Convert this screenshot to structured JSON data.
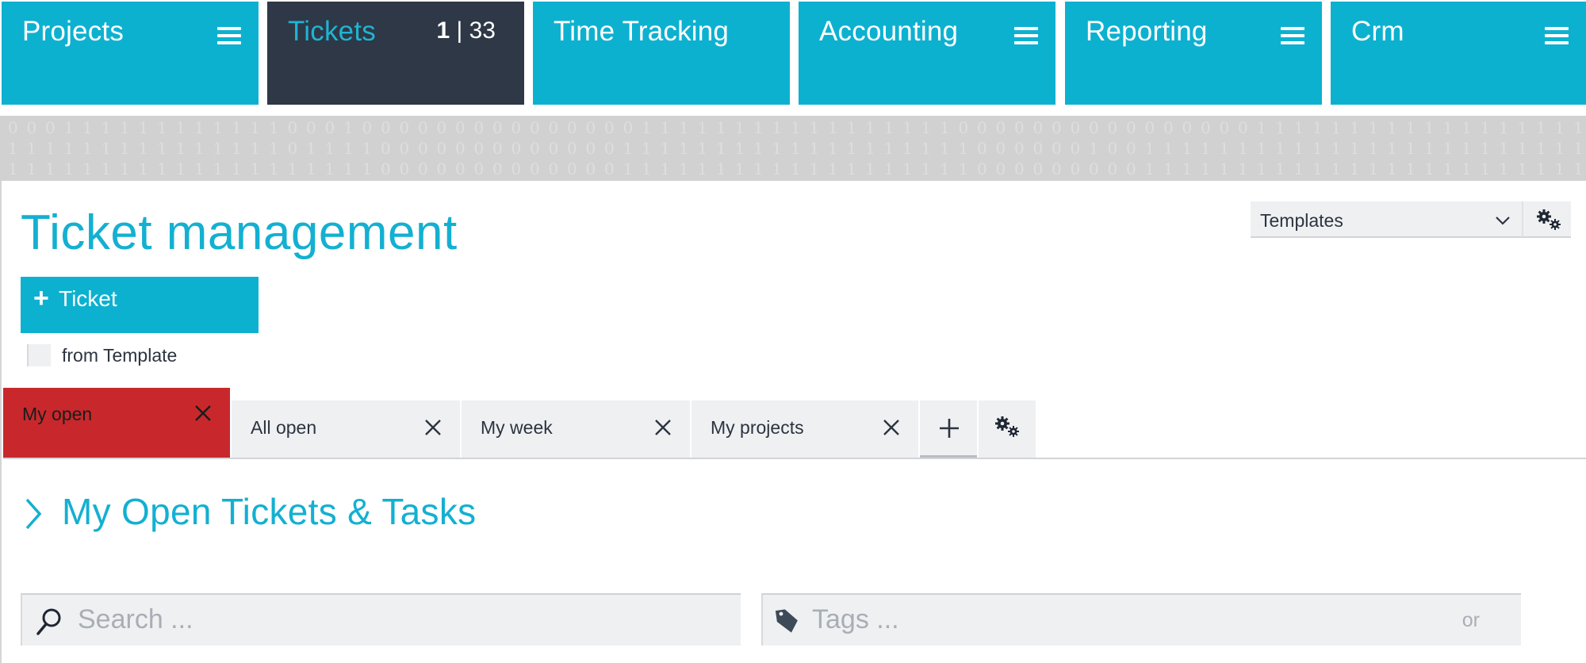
{
  "topnav": {
    "tiles": [
      {
        "label": "Projects",
        "icon": "menu-icon"
      },
      {
        "label": "Tickets",
        "badge_current": "1",
        "badge_separator": " | ",
        "badge_total": "33",
        "active": true
      },
      {
        "label": "Time Tracking"
      },
      {
        "label": "Accounting",
        "icon": "menu-icon"
      },
      {
        "label": "Reporting",
        "icon": "menu-icon"
      },
      {
        "label": "Crm",
        "icon": "menu-icon"
      }
    ]
  },
  "banner": {
    "rows": [
      "0001111111111110001000000000000000111111111111111110000000000000000111111111111111111",
      "1111111111111110111100000000000001111111111111111111000000100111111111111111111111111",
      "1111111111111111111100000000000001111111111111111111000000000111111111111111111111111"
    ]
  },
  "page": {
    "title": "Ticket management",
    "templates_select": {
      "value": "Templates",
      "icon": "chevron-down-icon"
    },
    "templates_settings_icon": "gears-icon",
    "add_ticket": {
      "icon": "plus-icon",
      "icon_glyph": "+",
      "label": "Ticket"
    },
    "from_template": {
      "label": "from Template",
      "checked": false
    }
  },
  "tabs": {
    "items": [
      {
        "label": "My open",
        "active": true
      },
      {
        "label": "All open"
      },
      {
        "label": "My week"
      },
      {
        "label": "My projects"
      }
    ],
    "add_icon": "plus-icon",
    "settings_icon": "gears-icon"
  },
  "section": {
    "title": "My Open Tickets & Tasks",
    "icon": "chevron-right-icon"
  },
  "filters": {
    "search": {
      "placeholder": "Search ...",
      "value": "",
      "icon": "search-icon"
    },
    "tags": {
      "placeholder": "Tags ...",
      "value": "",
      "icon": "tag-icon",
      "suffix": "or"
    }
  },
  "colors": {
    "accent": "#0db1d0",
    "nav_active_bg": "#2e3846",
    "active_tab": "#c8282c",
    "input_bg": "#eff0f2",
    "title_text": "#13b0d1",
    "banner_bg": "#d1d1d1"
  }
}
